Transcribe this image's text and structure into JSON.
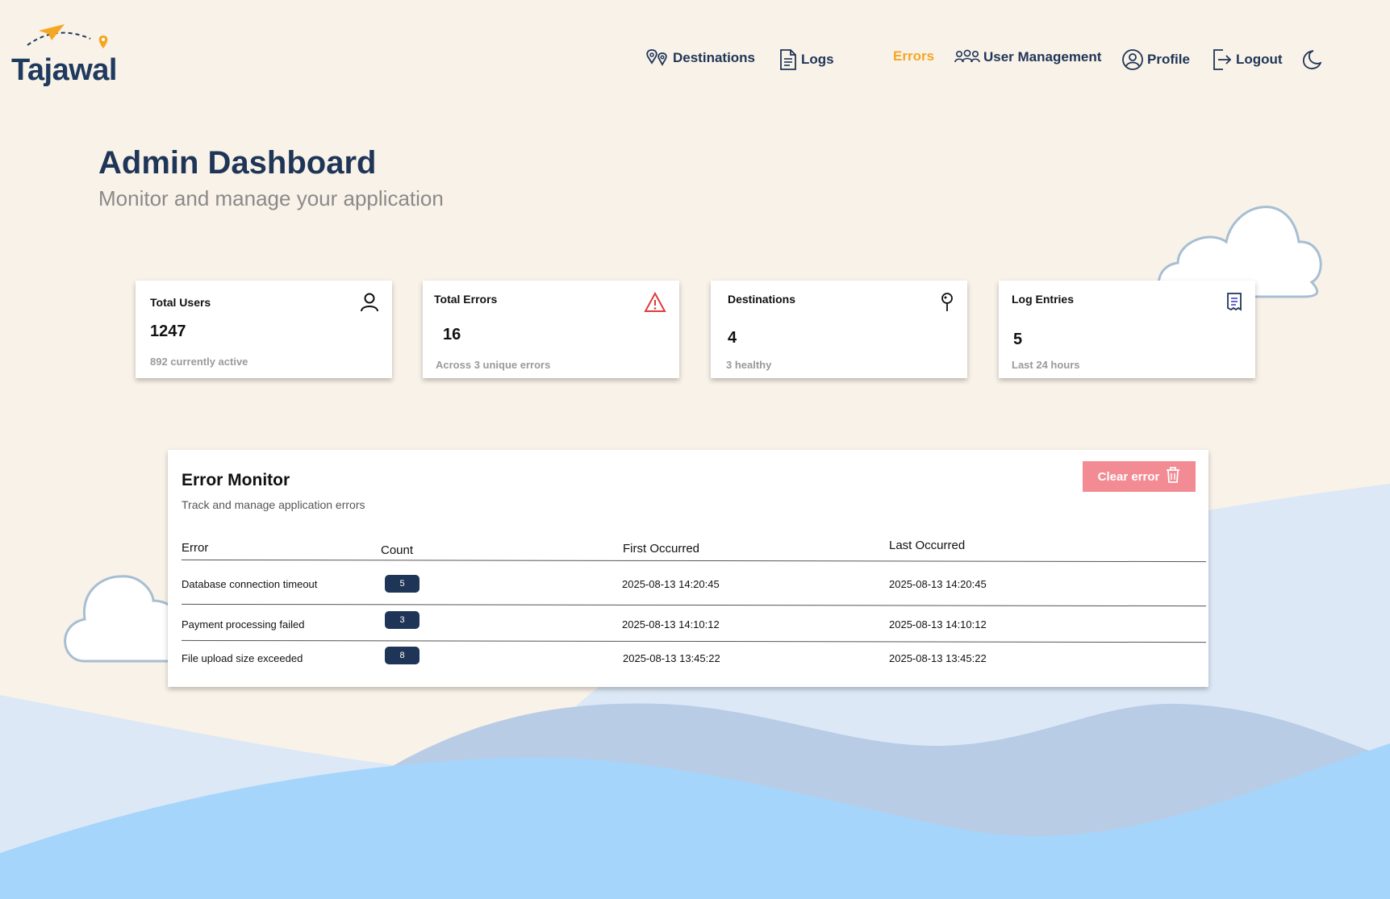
{
  "app": {
    "brand": "Tajawal"
  },
  "nav": {
    "destinations": "Destinations",
    "logs": "Logs",
    "errors": "Errors",
    "user_management": "User Management",
    "profile": "Profile",
    "logout": "Logout",
    "theme_toggle_icon": "moon-icon"
  },
  "page": {
    "title": "Admin Dashboard",
    "subtitle": "Monitor and manage your application"
  },
  "stats": [
    {
      "label": "Total Users",
      "value": "1247",
      "note": "892 currently active",
      "icon": "user-icon"
    },
    {
      "label": "Total Errors",
      "value": "16",
      "note": "Across 3 unique errors",
      "icon": "warning-icon"
    },
    {
      "label": "Destinations",
      "value": "4",
      "note": "3 healthy",
      "icon": "pin-icon"
    },
    {
      "label": "Log Entries",
      "value": "5",
      "note": "Last 24 hours",
      "icon": "receipt-icon"
    }
  ],
  "error_monitor": {
    "title": "Error Monitor",
    "subtitle": "Track and manage application errors",
    "clear_label": "Clear error",
    "columns": [
      "Error",
      "Count",
      "First Occurred",
      "Last Occurred"
    ],
    "rows": [
      {
        "error": "Database connection timeout",
        "count": "5",
        "first": "2025-08-13 14:20:45",
        "last": "2025-08-13 14:20:45"
      },
      {
        "error": "Payment processing failed",
        "count": "3",
        "first": "2025-08-13 14:10:12",
        "last": "2025-08-13 14:10:12"
      },
      {
        "error": "File upload size exceeded",
        "count": "8",
        "first": "2025-08-13 13:45:22",
        "last": "2025-08-13 13:45:22"
      }
    ]
  },
  "colors": {
    "background": "#f9f2e8",
    "primary": "#1f3557",
    "accent": "#f5a623",
    "danger_button": "#f28b93",
    "wave_light": "#dce8f6",
    "wave_mid": "#b8cce6",
    "wave_front": "#a6d5fb"
  }
}
